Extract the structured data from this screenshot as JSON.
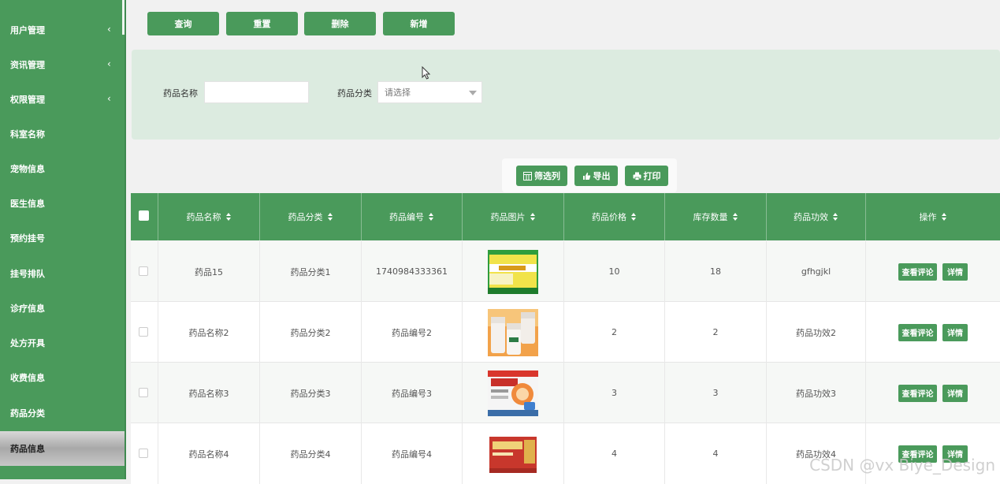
{
  "sidebar": {
    "items": [
      {
        "label": "用户管理",
        "has_submenu": true
      },
      {
        "label": "资讯管理",
        "has_submenu": true
      },
      {
        "label": "权限管理",
        "has_submenu": true
      },
      {
        "label": "科室名称",
        "has_submenu": false
      },
      {
        "label": "宠物信息",
        "has_submenu": false
      },
      {
        "label": "医生信息",
        "has_submenu": false
      },
      {
        "label": "预约挂号",
        "has_submenu": false
      },
      {
        "label": "挂号排队",
        "has_submenu": false
      },
      {
        "label": "诊疗信息",
        "has_submenu": false
      },
      {
        "label": "处方开具",
        "has_submenu": false
      },
      {
        "label": "收费信息",
        "has_submenu": false
      },
      {
        "label": "药品分类",
        "has_submenu": false
      },
      {
        "label": "药品信息",
        "has_submenu": false,
        "active": true
      }
    ]
  },
  "actions": {
    "query": "查询",
    "reset": "重置",
    "delete": "删除",
    "add": "新增"
  },
  "search": {
    "name_label": "药品名称",
    "name_value": "",
    "category_label": "药品分类",
    "category_placeholder": "请选择"
  },
  "toolbar": {
    "filter_columns": "筛选列",
    "export": "导出",
    "print": "打印"
  },
  "table": {
    "headers": [
      "药品名称",
      "药品分类",
      "药品编号",
      "药品图片",
      "药品价格",
      "库存数量",
      "药品功效",
      "操作"
    ],
    "rows": [
      {
        "name": "药品15",
        "category": "药品分类1",
        "code": "1740984333361",
        "image": "green-yellow-box",
        "price": "10",
        "stock": "18",
        "effect": "gfhgjkl"
      },
      {
        "name": "药品名称2",
        "category": "药品分类2",
        "code": "药品编号2",
        "image": "white-bottles",
        "price": "2",
        "stock": "2",
        "effect": "药品功效2"
      },
      {
        "name": "药品名称3",
        "category": "药品分类3",
        "code": "药品编号3",
        "image": "red-white-box",
        "price": "3",
        "stock": "3",
        "effect": "药品功效3"
      },
      {
        "name": "药品名称4",
        "category": "药品分类4",
        "code": "药品编号4",
        "image": "red-gold-box",
        "price": "4",
        "stock": "4",
        "effect": "药品功效4"
      }
    ],
    "row_actions": {
      "view_comments": "查看评论",
      "details": "详情"
    }
  },
  "watermark": "CSDN @vx Biye_Design",
  "colors": {
    "primary": "#4a9a5b",
    "search_panel": "#dcebe0",
    "background": "#f1f1f1"
  }
}
